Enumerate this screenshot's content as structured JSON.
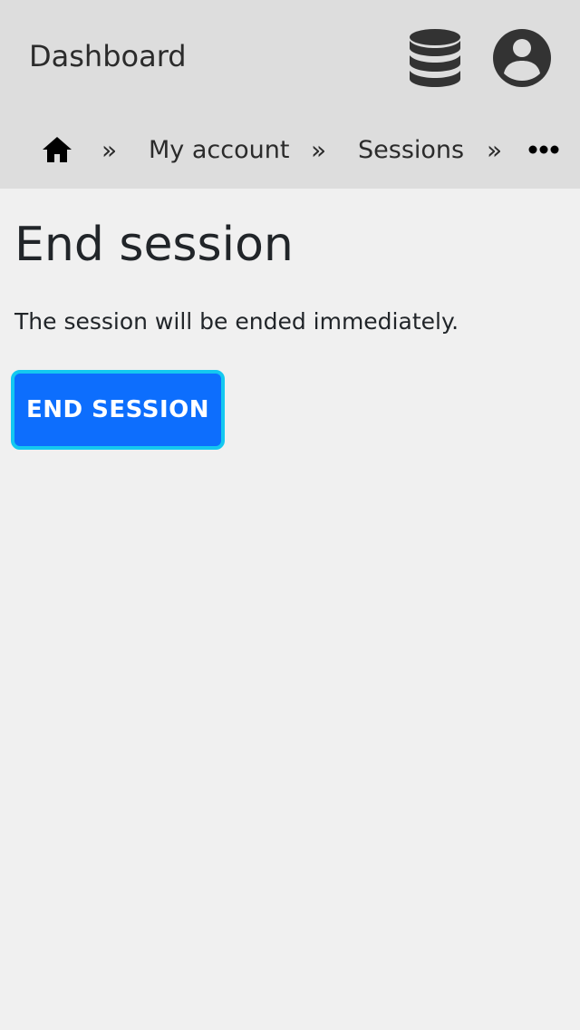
{
  "header": {
    "title": "Dashboard",
    "database_icon": "database-icon",
    "user_icon": "user-circle-icon"
  },
  "breadcrumb": {
    "home_icon": "home-icon",
    "separator": "»",
    "items": [
      {
        "label": "My account"
      },
      {
        "label": "Sessions"
      }
    ],
    "more_icon": "more-horizontal-icon"
  },
  "main": {
    "title": "End session",
    "description": "The session will be ended immediately.",
    "end_button_label": "END SESSION"
  },
  "colors": {
    "header_bg": "#dddddd",
    "page_bg": "#f0f0f0",
    "primary_button": "#0d6efd",
    "focus_ring": "#14c8f0",
    "icon_dark": "#333333"
  }
}
